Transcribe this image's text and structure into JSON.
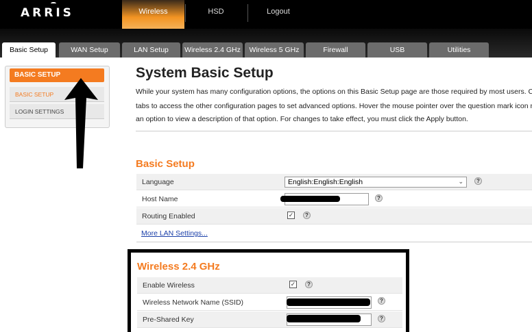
{
  "brand": "ARRIS",
  "top_nav": [
    "Wireless",
    "HSD",
    "Logout"
  ],
  "tabs": [
    "Basic Setup",
    "WAN Setup",
    "LAN Setup",
    "Wireless 2.4 GHz",
    "Wireless 5 GHz",
    "Firewall",
    "USB",
    "Utilities"
  ],
  "sidebar": {
    "heading": "BASIC SETUP",
    "items": [
      "BASIC SETUP",
      "LOGIN SETTINGS"
    ]
  },
  "main": {
    "title": "System Basic Setup",
    "intro": [
      "While your system has many configuration options, the options on this Basic Setup page are those required by most users. Click",
      "tabs to access the other configuration pages to set advanced options. Hover the mouse pointer over the question mark icon next",
      "an option to view a description of that option. For changes to take effect, you must click the Apply button."
    ],
    "basic_setup": {
      "title": "Basic Setup",
      "language_label": "Language",
      "language_value": "English:English:English",
      "host_name_label": "Host Name",
      "routing_label": "Routing Enabled",
      "routing_checked": true,
      "more_lan": "More LAN Settings..."
    },
    "wireless": {
      "title": "Wireless 2.4 GHz",
      "enable_label": "Enable Wireless",
      "enable_checked": true,
      "ssid_label": "Wireless Network Name (SSID)",
      "psk_label": "Pre-Shared Key"
    }
  },
  "colors": {
    "accent": "#f47b20",
    "topbar": "#000000",
    "tab_inactive": "#6c6c6c",
    "link": "#1a3fa8"
  },
  "icons": [
    "question-mark-icon",
    "checkbox-icon",
    "dropdown-arrow-icon",
    "annotation-arrow-icon"
  ]
}
